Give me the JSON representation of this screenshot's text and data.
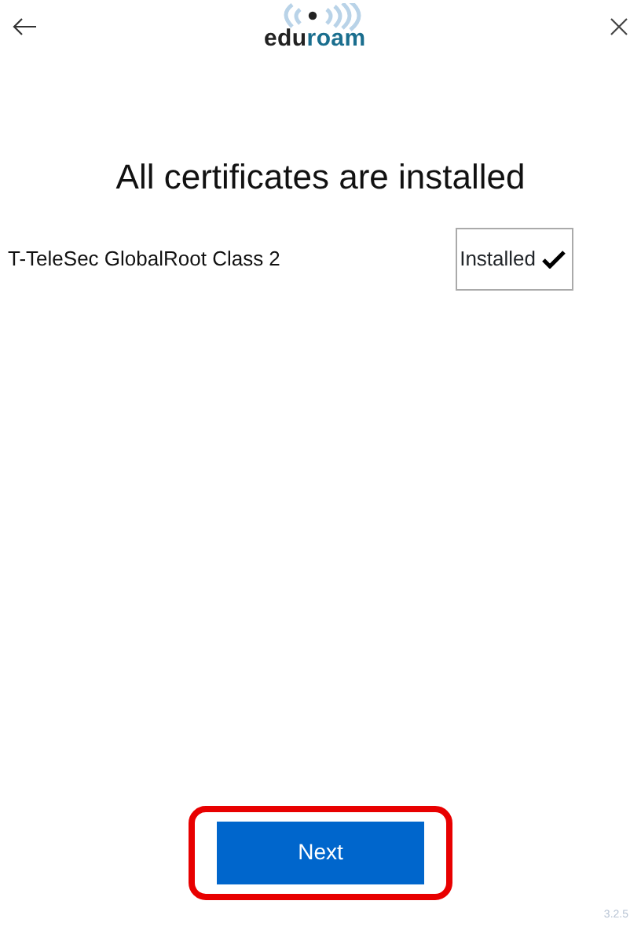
{
  "header": {
    "logo_parts": [
      "edu",
      "roam"
    ]
  },
  "title": "All certificates are installed",
  "certificates": [
    {
      "name": "T-TeleSec GlobalRoot Class 2",
      "status": "Installed",
      "installed": true
    }
  ],
  "next_button": {
    "label": "Next",
    "highlighted": true
  },
  "version": "3.2.5"
}
